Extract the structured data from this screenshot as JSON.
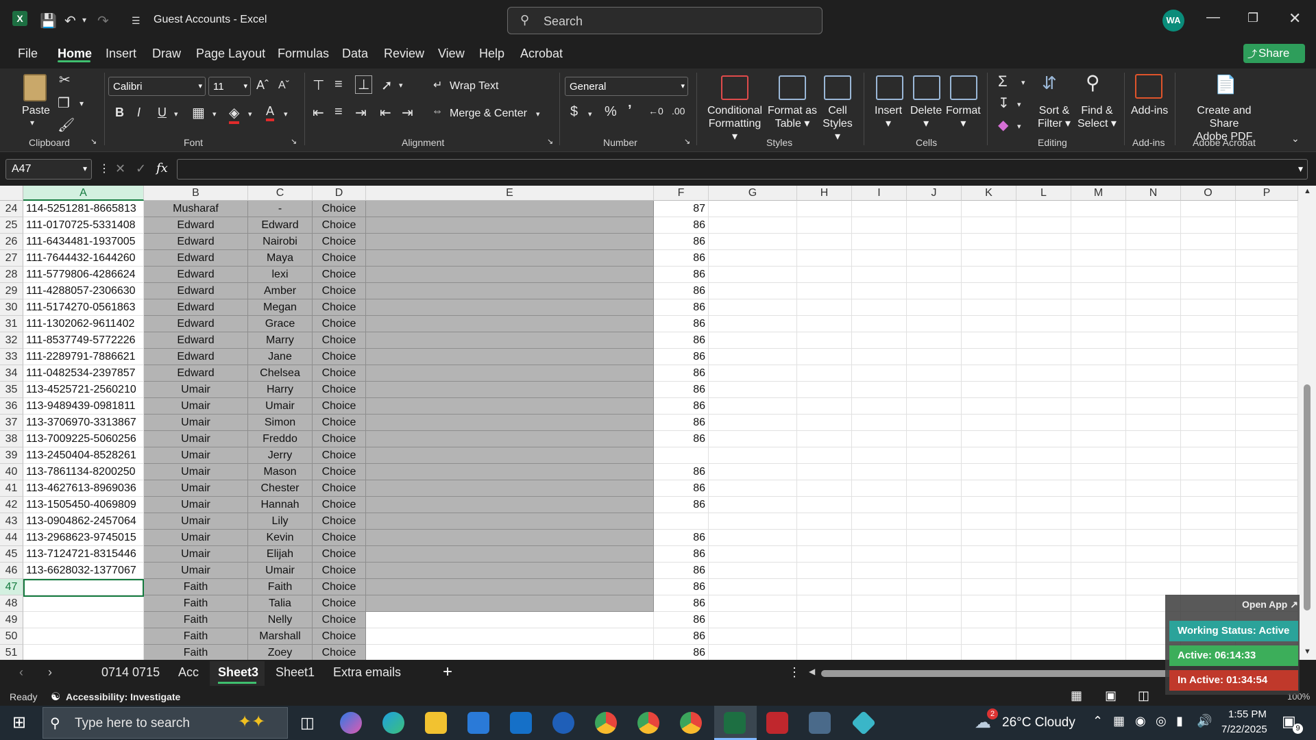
{
  "titlebar": {
    "title": "Guest Accounts  -  Excel",
    "search_placeholder": "Search",
    "avatar_initials": "WA"
  },
  "menu": [
    "File",
    "Home",
    "Insert",
    "Draw",
    "Page Layout",
    "Formulas",
    "Data",
    "Review",
    "View",
    "Help",
    "Acrobat"
  ],
  "share_label": "Share",
  "ribbon": {
    "paste": "Paste",
    "font_name": "Calibri",
    "font_size": "11",
    "wrap_text": "Wrap Text",
    "merge_center": "Merge & Center",
    "number_format": "General",
    "conditional_formatting": [
      "Conditional",
      "Formatting"
    ],
    "format_as_table": [
      "Format as",
      "Table"
    ],
    "cell_styles": [
      "Cell",
      "Styles"
    ],
    "insert": "Insert",
    "delete": "Delete",
    "format": "Format",
    "sort_filter": [
      "Sort &",
      "Filter"
    ],
    "find_select": [
      "Find &",
      "Select"
    ],
    "add_ins": "Add-ins",
    "create_pdf": [
      "Create and Share",
      "Adobe PDF"
    ],
    "groups": {
      "clipboard": "Clipboard",
      "font": "Font",
      "alignment": "Alignment",
      "number": "Number",
      "styles": "Styles",
      "cells": "Cells",
      "editing": "Editing",
      "add_ins": "Add-ins",
      "adobe": "Adobe Acrobat"
    }
  },
  "namebox": "A47",
  "fx": "fx",
  "columns": [
    "A",
    "B",
    "C",
    "D",
    "E",
    "F",
    "G",
    "H",
    "I",
    "J",
    "K",
    "L",
    "M",
    "N",
    "O",
    "P"
  ],
  "rows": [
    {
      "n": "24",
      "a": "114-5251281-8665813",
      "b": "Musharaf",
      "c": "-",
      "d": "Choice",
      "f": "87"
    },
    {
      "n": "25",
      "a": "111-0170725-5331408",
      "b": "Edward",
      "c": "Edward",
      "d": "Choice",
      "f": "86"
    },
    {
      "n": "26",
      "a": "111-6434481-1937005",
      "b": "Edward",
      "c": "Nairobi",
      "d": "Choice",
      "f": "86"
    },
    {
      "n": "27",
      "a": "111-7644432-1644260",
      "b": "Edward",
      "c": "Maya",
      "d": "Choice",
      "f": "86"
    },
    {
      "n": "28",
      "a": "111-5779806-4286624",
      "b": "Edward",
      "c": "lexi",
      "d": "Choice",
      "f": "86"
    },
    {
      "n": "29",
      "a": "111-4288057-2306630",
      "b": "Edward",
      "c": "Amber",
      "d": "Choice",
      "f": "86"
    },
    {
      "n": "30",
      "a": "111-5174270-0561863",
      "b": "Edward",
      "c": "Megan",
      "d": "Choice",
      "f": "86"
    },
    {
      "n": "31",
      "a": "111-1302062-9611402",
      "b": "Edward",
      "c": "Grace",
      "d": "Choice",
      "f": "86"
    },
    {
      "n": "32",
      "a": "111-8537749-5772226",
      "b": "Edward",
      "c": "Marry",
      "d": "Choice",
      "f": "86"
    },
    {
      "n": "33",
      "a": "111-2289791-7886621",
      "b": "Edward",
      "c": "Jane",
      "d": "Choice",
      "f": "86"
    },
    {
      "n": "34",
      "a": "111-0482534-2397857",
      "b": "Edward",
      "c": "Chelsea",
      "d": "Choice",
      "f": "86"
    },
    {
      "n": "35",
      "a": "113-4525721-2560210",
      "b": "Umair",
      "c": "Harry",
      "d": "Choice",
      "f": "86"
    },
    {
      "n": "36",
      "a": "113-9489439-0981811",
      "b": "Umair",
      "c": "Umair",
      "d": "Choice",
      "f": "86"
    },
    {
      "n": "37",
      "a": "113-3706970-3313867",
      "b": "Umair",
      "c": "Simon",
      "d": "Choice",
      "f": "86"
    },
    {
      "n": "38",
      "a": "113-7009225-5060256",
      "b": "Umair",
      "c": "Freddo",
      "d": "Choice",
      "f": "86"
    },
    {
      "n": "39",
      "a": "113-2450404-8528261",
      "b": "Umair",
      "c": "Jerry",
      "d": "Choice",
      "f": ""
    },
    {
      "n": "40",
      "a": "113-7861134-8200250",
      "b": "Umair",
      "c": "Mason",
      "d": "Choice",
      "f": "86"
    },
    {
      "n": "41",
      "a": "113-4627613-8969036",
      "b": "Umair",
      "c": "Chester",
      "d": "Choice",
      "f": "86"
    },
    {
      "n": "42",
      "a": "113-1505450-4069809",
      "b": "Umair",
      "c": "Hannah",
      "d": "Choice",
      "f": "86"
    },
    {
      "n": "43",
      "a": "113-0904862-2457064",
      "b": "Umair",
      "c": "Lily",
      "d": "Choice",
      "f": ""
    },
    {
      "n": "44",
      "a": "113-2968623-9745015",
      "b": "Umair",
      "c": "Kevin",
      "d": "Choice",
      "f": "86"
    },
    {
      "n": "45",
      "a": "113-7124721-8315446",
      "b": "Umair",
      "c": "Elijah",
      "d": "Choice",
      "f": "86"
    },
    {
      "n": "46",
      "a": "113-6628032-1377067",
      "b": "Umair",
      "c": "Umair",
      "d": "Choice",
      "f": "86"
    },
    {
      "n": "47",
      "a": "",
      "b": "Faith",
      "c": "Faith",
      "d": "Choice",
      "f": "86"
    },
    {
      "n": "48",
      "a": "",
      "b": "Faith",
      "c": "Talia",
      "d": "Choice",
      "f": "86"
    },
    {
      "n": "49",
      "a": "",
      "b": "Faith",
      "c": "Nelly",
      "d": "Choice",
      "f": "86"
    },
    {
      "n": "50",
      "a": "",
      "b": "Faith",
      "c": "Marshall",
      "d": "Choice",
      "f": "86"
    },
    {
      "n": "51",
      "a": "",
      "b": "Faith",
      "c": "Zoey",
      "d": "Choice",
      "f": "86"
    }
  ],
  "sheet_tabs": [
    "0714 0715",
    "Acc",
    "Sheet3",
    "Sheet1",
    "Extra emails"
  ],
  "active_sheet": "Sheet3",
  "status": {
    "ready": "Ready",
    "accessibility": "Accessibility: Investigate",
    "zoom": "100%"
  },
  "overlay": {
    "open_app": "Open App",
    "working_status": "Working Status: Active",
    "active": "Active: 06:14:33",
    "inactive": "In Active: 01:34:54"
  },
  "taskbar": {
    "search_placeholder": "Type here to search",
    "weather": "26°C  Cloudy",
    "weather_badge": "2",
    "time": "1:55 PM",
    "date": "7/22/2025",
    "notif_count": "9"
  },
  "colors": {
    "excel_green": "#137a3e",
    "gray_fill": "#b4b4b4",
    "overlay_teal": "#2ba39a",
    "overlay_green": "#3cae5a",
    "overlay_red": "#c0392b"
  }
}
